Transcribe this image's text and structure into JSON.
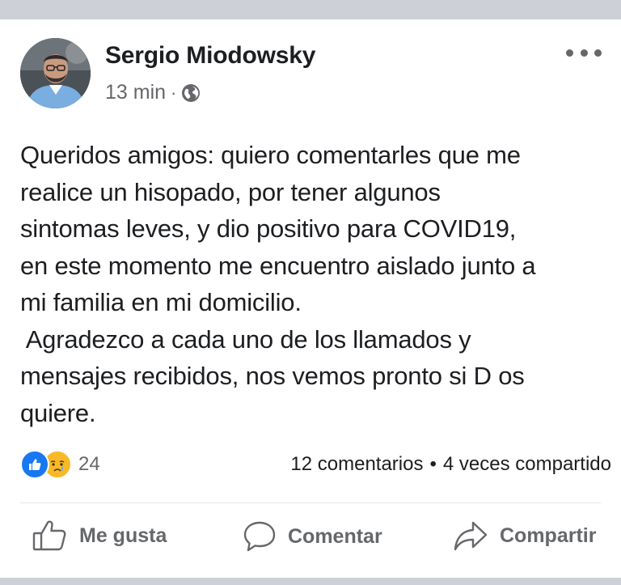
{
  "post": {
    "author": "Sergio Miodowsky",
    "time": "13 min",
    "separator": "·",
    "privacy_icon": "globe-icon",
    "more_icon": "ellipsis-icon",
    "text_lines": [
      "Queridos amigos: quiero comentarles que me",
      "realice un hisopado, por tener algunos",
      "sintomas leves, y dio positivo para COVID19,",
      "en este momento me encuentro aislado junto a",
      "mi familia en mi domicilio.",
      " Agradezco a cada uno de los llamados y",
      "mensajes recibidos, nos vemos pronto si D os",
      "quiere."
    ],
    "reactions": {
      "icons": [
        "like-reaction-icon",
        "sad-reaction-icon"
      ],
      "count": "24"
    },
    "stats": {
      "comments": "12 comentarios",
      "separator": "•",
      "shares": "4 veces compartido"
    },
    "actions": {
      "like": "Me gusta",
      "comment": "Comentar",
      "share": "Compartir"
    }
  },
  "colors": {
    "background": "#cdd0d6",
    "text": "#1c1e21",
    "secondary_text": "#65676b",
    "like_blue": "#1877f2",
    "sad_yellow": "#f7b928"
  }
}
